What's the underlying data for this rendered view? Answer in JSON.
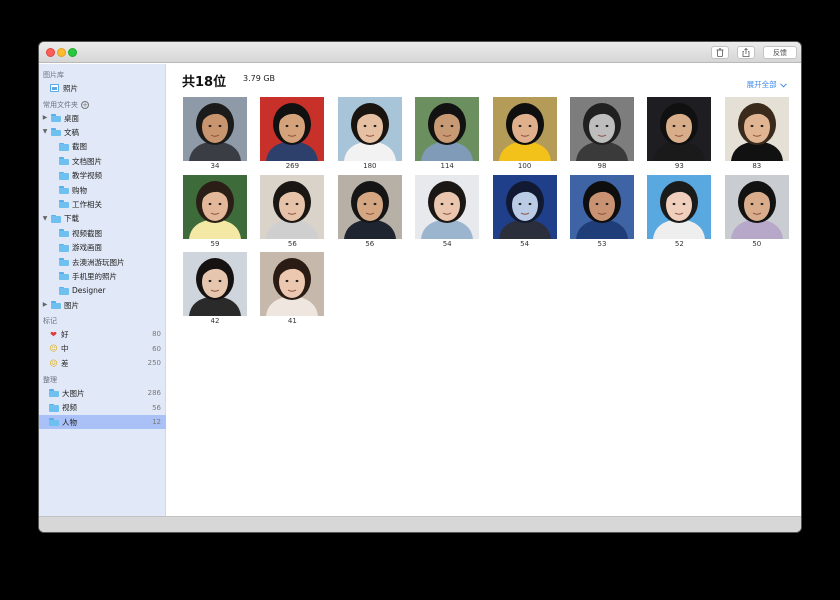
{
  "titlebar": {
    "feedback_label": "反馈",
    "trash_icon": "trash-icon",
    "share_icon": "share-icon"
  },
  "sidebar": {
    "library_heading": "图片库",
    "library_items": [
      {
        "label": "照片",
        "icon": "photo-icon"
      }
    ],
    "folders_heading": "常用文件夹",
    "folders": [
      {
        "label": "桌面",
        "expanded": false,
        "level": 0
      },
      {
        "label": "文稿",
        "expanded": true,
        "level": 0
      },
      {
        "label": "截图",
        "level": 1
      },
      {
        "label": "文档图片",
        "level": 1
      },
      {
        "label": "教学视频",
        "level": 1
      },
      {
        "label": "购物",
        "level": 1
      },
      {
        "label": "工作相关",
        "level": 1
      },
      {
        "label": "下载",
        "expanded": true,
        "level": 0
      },
      {
        "label": "视频截图",
        "level": 1
      },
      {
        "label": "游戏画面",
        "level": 1
      },
      {
        "label": "去澳洲游玩图片",
        "level": 1
      },
      {
        "label": "手机里的照片",
        "level": 1
      },
      {
        "label": "Designer",
        "level": 1
      },
      {
        "label": "图片",
        "expanded": false,
        "level": 0
      }
    ],
    "tags_heading": "标记",
    "tags": [
      {
        "label": "好",
        "count": "80",
        "icon": "heart-icon",
        "glyph": "❤",
        "color": "#e53935"
      },
      {
        "label": "中",
        "count": "60",
        "icon": "neutral-face-icon",
        "glyph": "😐",
        "color": "#e0a800"
      },
      {
        "label": "差",
        "count": "250",
        "icon": "sad-face-icon",
        "glyph": "😖",
        "color": "#e0a800"
      }
    ],
    "organize_heading": "整理",
    "organize": [
      {
        "label": "大图片",
        "count": "286",
        "icon": "large-image-icon",
        "selected": false
      },
      {
        "label": "视频",
        "count": "56",
        "icon": "video-icon",
        "selected": false
      },
      {
        "label": "人物",
        "count": "12",
        "icon": "people-icon",
        "selected": true
      }
    ]
  },
  "main": {
    "title": "共18位",
    "size": "3.79 GB",
    "expand_label": "展开全部",
    "people": [
      {
        "count": "34",
        "bg": "#8f9aa8",
        "skin": "#c9956e",
        "hair": "#1b1b1b",
        "shirt": "#3b3d44"
      },
      {
        "count": "269",
        "bg": "#c8302a",
        "skin": "#d4a27b",
        "hair": "#111111",
        "shirt": "#2d3f6b"
      },
      {
        "count": "180",
        "bg": "#a7c4d9",
        "skin": "#e6c0a2",
        "hair": "#1a1410",
        "shirt": "#f2f2f2"
      },
      {
        "count": "114",
        "bg": "#6b8f5e",
        "skin": "#c79a74",
        "hair": "#121212",
        "shirt": "#7f9bb8"
      },
      {
        "count": "100",
        "bg": "#b59b58",
        "skin": "#e0b08d",
        "hair": "#0f0f0f",
        "shirt": "#f2c21a"
      },
      {
        "count": "98",
        "bg": "#7d7d7d",
        "skin": "#bdbdbd",
        "hair": "#202020",
        "shirt": "#3a3a3a"
      },
      {
        "count": "93",
        "bg": "#1d1d22",
        "skin": "#d8ad8a",
        "hair": "#101010",
        "shirt": "#1a1a1a"
      },
      {
        "count": "83",
        "bg": "#e5e0d6",
        "skin": "#e2b592",
        "hair": "#3a2a1c",
        "shirt": "#111111"
      },
      {
        "count": "59",
        "bg": "#3e6b3a",
        "skin": "#e3b89a",
        "hair": "#2a1e16",
        "shirt": "#f4e9a4"
      },
      {
        "count": "56",
        "bg": "#d9d3c9",
        "skin": "#e6c3a8",
        "hair": "#1a1614",
        "shirt": "#cfcfcf"
      },
      {
        "count": "56",
        "bg": "#b6b0a6",
        "skin": "#d4a682",
        "hair": "#151515",
        "shirt": "#1e2430"
      },
      {
        "count": "54",
        "bg": "#e8e9ec",
        "skin": "#e9c6ad",
        "hair": "#1b1715",
        "shirt": "#9bb5cf"
      },
      {
        "count": "54",
        "bg": "#1f3f8a",
        "skin": "#b9cbe5",
        "hair": "#121a33",
        "shirt": "#2b2f3c"
      },
      {
        "count": "53",
        "bg": "#3e64a5",
        "skin": "#c99272",
        "hair": "#0e0e0e",
        "shirt": "#1f3d78"
      },
      {
        "count": "52",
        "bg": "#5aa8e0",
        "skin": "#f0cfbd",
        "hair": "#1b1b1b",
        "shirt": "#eeeeee"
      },
      {
        "count": "50",
        "bg": "#c9ccd1",
        "skin": "#d9ad8c",
        "hair": "#121212",
        "shirt": "#b7a8c9"
      },
      {
        "count": "42",
        "bg": "#cfd5dc",
        "skin": "#e6c6ae",
        "hair": "#161212",
        "shirt": "#2a2a2a"
      },
      {
        "count": "41",
        "bg": "#c6b8aa",
        "skin": "#ecc8b0",
        "hair": "#2a1c14",
        "shirt": "#efe6df"
      }
    ]
  }
}
